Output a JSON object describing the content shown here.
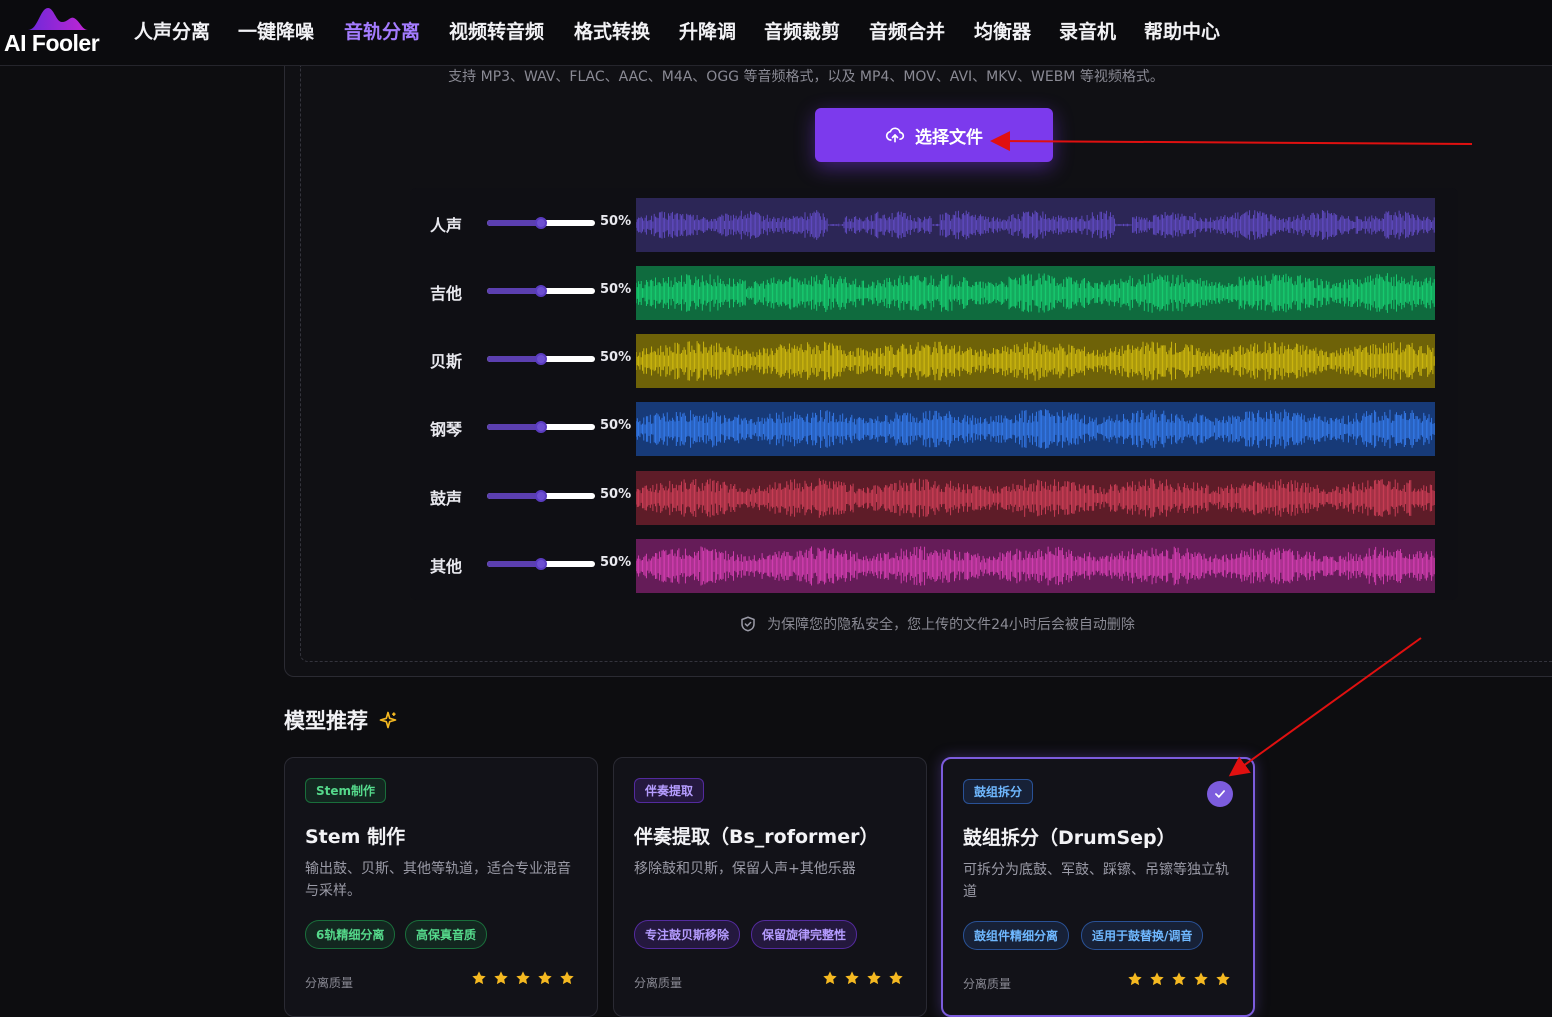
{
  "nav": {
    "logo_text": "AI Fooler",
    "items": [
      {
        "label": "人声分离",
        "active": false
      },
      {
        "label": "一键降噪",
        "active": false
      },
      {
        "label": "音轨分离",
        "active": true
      },
      {
        "label": "视频转音频",
        "active": false
      },
      {
        "label": "格式转换",
        "active": false
      },
      {
        "label": "升降调",
        "active": false
      },
      {
        "label": "音频裁剪",
        "active": false
      },
      {
        "label": "音频合并",
        "active": false
      },
      {
        "label": "均衡器",
        "active": false
      },
      {
        "label": "录音机",
        "active": false
      },
      {
        "label": "帮助中心",
        "active": false
      }
    ]
  },
  "upload": {
    "formats_text": "支持 MP3、WAV、FLAC、AAC、M4A、OGG 等音频格式，以及 MP4、MOV、AVI、MKV、WEBM 等视频格式。",
    "choose_button": "选择文件",
    "privacy_text": "为保障您的隐私安全，您上传的文件24小时后会被自动删除"
  },
  "tracks": [
    {
      "label": "人声",
      "volume": 0.5,
      "volume_text": "50%",
      "color": "#6a52d6",
      "bg": "#2c2656"
    },
    {
      "label": "吉他",
      "volume": 0.5,
      "volume_text": "50%",
      "color": "#19e07a",
      "bg": "#0f6b3e"
    },
    {
      "label": "贝斯",
      "volume": 0.5,
      "volume_text": "50%",
      "color": "#e0c810",
      "bg": "#6e6208"
    },
    {
      "label": "钢琴",
      "volume": 0.5,
      "volume_text": "50%",
      "color": "#3a86ff",
      "bg": "#173a78"
    },
    {
      "label": "鼓声",
      "volume": 0.5,
      "volume_text": "50%",
      "color": "#e0445f",
      "bg": "#5e1c28"
    },
    {
      "label": "其他",
      "volume": 0.5,
      "volume_text": "50%",
      "color": "#e845c2",
      "bg": "#651c58"
    }
  ],
  "models": {
    "title": "模型推荐",
    "cards": [
      {
        "badge": "Stem制作",
        "title": "Stem 制作",
        "desc": "输出鼓、贝斯、其他等轨道，适合专业混音与采样。",
        "tags": [
          "6轨精细分离",
          "高保真音质"
        ],
        "quality_label": "分离质量",
        "stars": 5,
        "selected": false
      },
      {
        "badge": "伴奏提取",
        "title": "伴奏提取（Bs_roformer）",
        "desc": "移除鼓和贝斯，保留人声+其他乐器",
        "tags": [
          "专注鼓贝斯移除",
          "保留旋律完整性"
        ],
        "quality_label": "分离质量",
        "stars": 4,
        "selected": false
      },
      {
        "badge": "鼓组拆分",
        "title": "鼓组拆分（DrumSep）",
        "desc": "可拆分为底鼓、军鼓、踩镲、吊镲等独立轨道",
        "tags": [
          "鼓组件精细分离",
          "适用于鼓替换/调音"
        ],
        "quality_label": "分离质量",
        "stars": 5,
        "selected": true
      }
    ]
  },
  "colors": {
    "accent": "#7c3aed",
    "star": "#f5b921",
    "arrow": "#e01010"
  }
}
